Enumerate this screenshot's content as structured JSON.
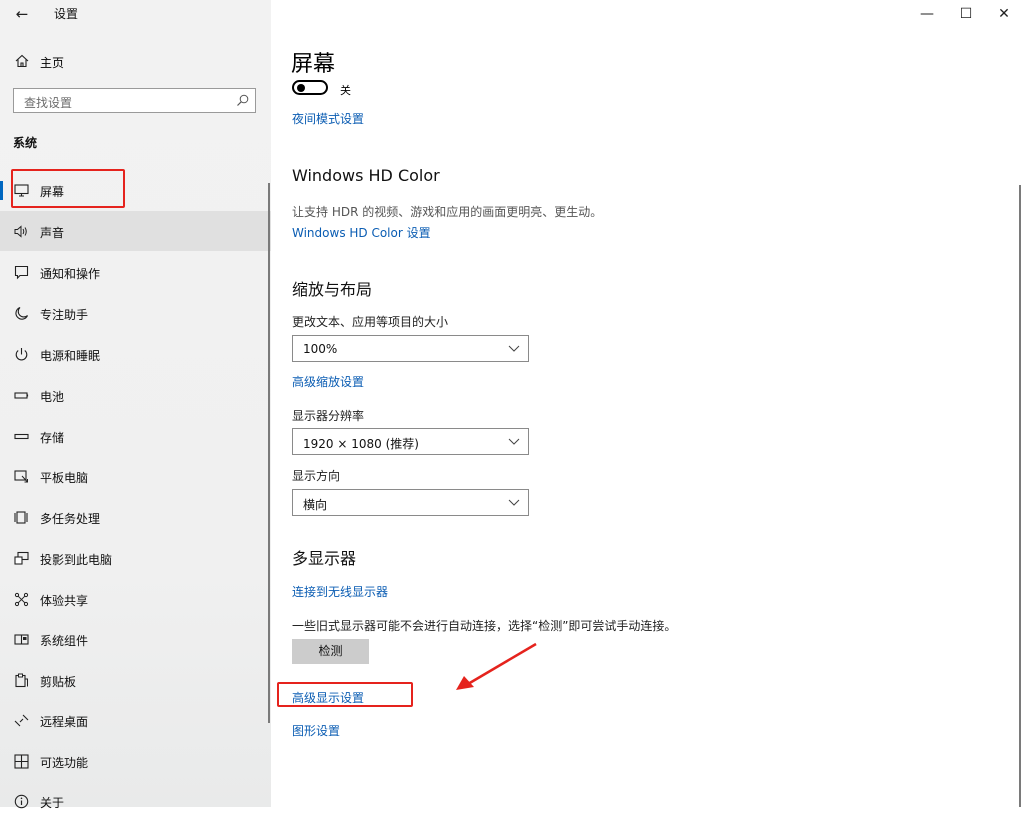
{
  "window": {
    "title": "设置",
    "controls": {
      "minimize": "—",
      "maximize": "☐",
      "close": "✕"
    }
  },
  "sidebar": {
    "home_label": "主页",
    "search_placeholder": "查找设置",
    "section_title": "系统",
    "items": [
      {
        "label": "屏幕",
        "icon": "monitor-icon",
        "selected": true
      },
      {
        "label": "声音",
        "icon": "speaker-icon"
      },
      {
        "label": "通知和操作",
        "icon": "notification-icon"
      },
      {
        "label": "专注助手",
        "icon": "moon-icon"
      },
      {
        "label": "电源和睡眠",
        "icon": "power-icon"
      },
      {
        "label": "电池",
        "icon": "battery-icon"
      },
      {
        "label": "存储",
        "icon": "storage-icon"
      },
      {
        "label": "平板电脑",
        "icon": "tablet-icon"
      },
      {
        "label": "多任务处理",
        "icon": "multitask-icon"
      },
      {
        "label": "投影到此电脑",
        "icon": "project-icon"
      },
      {
        "label": "体验共享",
        "icon": "share-icon"
      },
      {
        "label": "系统组件",
        "icon": "components-icon"
      },
      {
        "label": "剪贴板",
        "icon": "clipboard-icon"
      },
      {
        "label": "远程桌面",
        "icon": "remote-desktop-icon"
      },
      {
        "label": "可选功能",
        "icon": "optional-features-icon"
      },
      {
        "label": "关于",
        "icon": "info-icon"
      }
    ]
  },
  "main": {
    "page_title": "屏幕",
    "night_light": {
      "state_label": "关",
      "link": "夜间模式设置"
    },
    "hdr": {
      "heading": "Windows HD Color",
      "description": "让支持 HDR 的视频、游戏和应用的画面更明亮、更生动。",
      "link": "Windows HD Color 设置"
    },
    "scale": {
      "heading": "缩放与布局",
      "text_size_label": "更改文本、应用等项目的大小",
      "text_size_value": "100%",
      "advanced_link": "高级缩放设置",
      "resolution_label": "显示器分辨率",
      "resolution_value": "1920 × 1080 (推荐)",
      "orientation_label": "显示方向",
      "orientation_value": "横向"
    },
    "multi": {
      "heading": "多显示器",
      "wireless_link": "连接到无线显示器",
      "hint": "一些旧式显示器可能不会进行自动连接，选择“检测”即可尝试手动连接。",
      "detect_button": "检测",
      "advanced_display_link": "高级显示设置",
      "graphics_link": "图形设置"
    }
  },
  "colors": {
    "accent": "#0067c0",
    "link": "#0b5db3",
    "annotation_red": "#e5231d",
    "sidebar_bg": "#f2f2f2"
  }
}
